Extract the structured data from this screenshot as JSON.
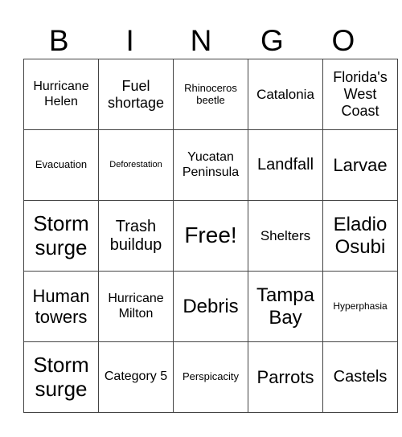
{
  "header": [
    "B",
    "I",
    "N",
    "G",
    "O"
  ],
  "rows": [
    [
      "Hurricane Helen",
      "Fuel shortage",
      "Rhinoceros beetle",
      "Catalonia",
      "Florida's West Coast"
    ],
    [
      "Evacuation",
      "Deforestation",
      "Yucatan Peninsula",
      "Landfall",
      "Larvae"
    ],
    [
      "Storm surge",
      "Trash buildup",
      "Free!",
      "Shelters",
      "Eladio Osubi"
    ],
    [
      "Human towers",
      "Hurricane Milton",
      "Debris",
      "Tampa Bay",
      "Hyperphasia"
    ],
    [
      "Storm surge",
      "Category 5",
      "Perspicacity",
      "Parrots",
      "Castels"
    ]
  ]
}
